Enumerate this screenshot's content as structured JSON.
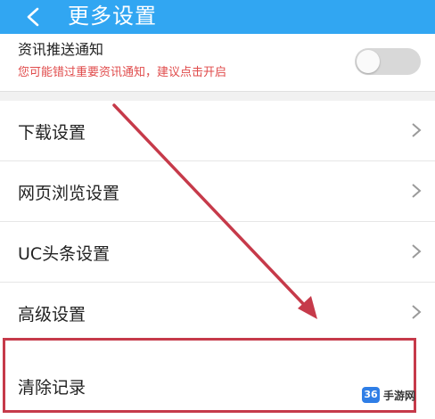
{
  "header": {
    "title": "更多设置",
    "background": "#31a6f2"
  },
  "notification": {
    "title": "资讯推送通知",
    "subtitle": "您可能错过重要资讯通知，建议点击开启",
    "toggle_state": "off"
  },
  "settings": {
    "items": [
      {
        "label": "下载设置"
      },
      {
        "label": "网页浏览设置"
      },
      {
        "label": "UC头条设置"
      },
      {
        "label": "高级设置"
      }
    ],
    "clear_records_label": "清除记录"
  },
  "watermark": {
    "badge": "36",
    "text": "手游网"
  },
  "colors": {
    "accent": "#31a6f2",
    "highlight": "#c63a4a",
    "warning_text": "#e04b4b"
  }
}
